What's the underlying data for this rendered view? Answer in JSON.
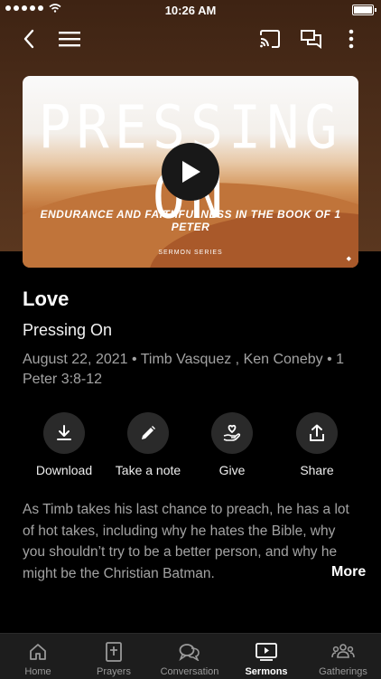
{
  "status_bar": {
    "time": "10:26 AM"
  },
  "hero": {
    "title": "PRESSING ON",
    "subtitle": "ENDURANCE AND FAITHFULNESS IN THE BOOK OF 1 PETER",
    "series_label": "SERMON SERIES"
  },
  "sermon": {
    "title": "Love",
    "series": "Pressing On",
    "meta": "August 22, 2021 • Timb Vasquez  , Ken Coneby • 1 Peter 3:8-12"
  },
  "actions": [
    {
      "label": "Download",
      "icon": "download-icon"
    },
    {
      "label": "Take a note",
      "icon": "pencil-icon"
    },
    {
      "label": "Give",
      "icon": "give-heart-icon"
    },
    {
      "label": "Share",
      "icon": "share-icon"
    }
  ],
  "description": {
    "text": "As Timb takes his last chance to preach, he has a lot of hot takes, including why he hates the Bible, why you shouldn’t try to be a better person, and why he might be the Christian Batman.",
    "more_label": "More"
  },
  "tabs": [
    {
      "label": "Home",
      "icon": "home-icon",
      "active": false
    },
    {
      "label": "Prayers",
      "icon": "prayer-book-icon",
      "active": false
    },
    {
      "label": "Conversation",
      "icon": "chat-icon",
      "active": false
    },
    {
      "label": "Sermons",
      "icon": "sermons-play-icon",
      "active": true
    },
    {
      "label": "Gatherings",
      "icon": "people-icon",
      "active": false
    }
  ],
  "colors": {
    "background": "#000000",
    "header_brown": "#4a2c19",
    "muted_text": "#a3a3a3",
    "tabbar": "#1d1d1d"
  }
}
